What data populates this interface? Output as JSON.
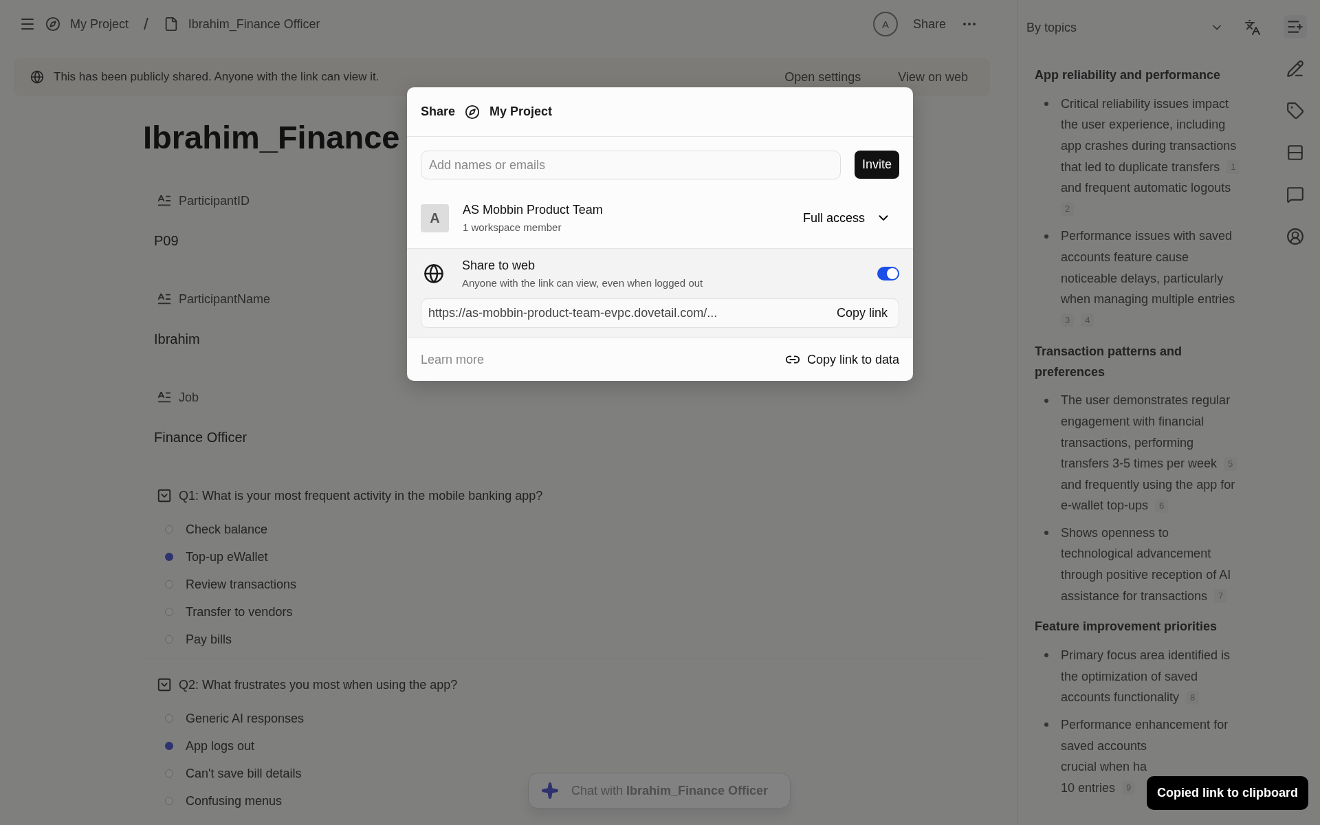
{
  "topbar": {
    "breadcrumb": [
      {
        "kind": "project",
        "label": "My Project"
      },
      {
        "kind": "document",
        "label": "Ibrahim_Finance Officer"
      }
    ],
    "separator": "/",
    "avatar": "A",
    "share": "Share"
  },
  "banner": {
    "text": "This has been publicly shared. Anyone with the link can view it.",
    "actions": [
      "Open settings",
      "View on web"
    ]
  },
  "document": {
    "title": "Ibrahim_Finance",
    "fields": [
      {
        "label": "ParticipantID",
        "value": "P09"
      },
      {
        "label": "ParticipantName",
        "value": "Ibrahim"
      },
      {
        "label": "Job",
        "value": "Finance Officer"
      }
    ],
    "questions": [
      {
        "label": "Q1: What is your most frequent activity in the mobile banking app?",
        "options": [
          {
            "label": "Check balance",
            "selected": false
          },
          {
            "label": "Top-up eWallet",
            "selected": true
          },
          {
            "label": "Review transactions",
            "selected": false
          },
          {
            "label": "Transfer to vendors",
            "selected": false
          },
          {
            "label": "Pay bills",
            "selected": false
          }
        ]
      },
      {
        "label": "Q2: What frustrates you most when using the app?",
        "options": [
          {
            "label": "Generic AI responses",
            "selected": false
          },
          {
            "label": "App logs out",
            "selected": true
          },
          {
            "label": "Can't save bill details",
            "selected": false
          },
          {
            "label": "Confusing menus",
            "selected": false
          }
        ]
      }
    ]
  },
  "chat": {
    "placeholder": "Chat with **Ibrahim_Finance Officer**"
  },
  "sidebar": {
    "grouping": "By topics",
    "sections": [
      {
        "heading": "App reliability and performance",
        "bullets": [
          {
            "lines": [
              {
                "text": "Critical reliability issues impact"
              },
              {
                "text": "the user experience, including"
              },
              {
                "text": "app crashes during transactions"
              },
              {
                "text": "that led to duplicate transfers",
                "citations": [
                  "1"
                ]
              },
              {
                "text": "and frequent automatic logouts"
              },
              {
                "citations": [
                  "2"
                ]
              }
            ]
          },
          {
            "lines": [
              {
                "text": "Performance issues with saved"
              },
              {
                "text": "accounts feature cause"
              },
              {
                "text": "noticeable delays, particularly"
              },
              {
                "text": "when managing multiple entries"
              },
              {
                "citations": [
                  "3",
                  "4"
                ]
              }
            ]
          }
        ]
      },
      {
        "heading": "Transaction patterns and preferences",
        "bullets": [
          {
            "lines": [
              {
                "text": "The user demonstrates regular"
              },
              {
                "text": "engagement with financial"
              },
              {
                "text": "transactions, performing"
              },
              {
                "text": "transfers 3-5 times per week",
                "citations": [
                  "5"
                ]
              },
              {
                "text": "and frequently using the app for"
              },
              {
                "text": "e-wallet top-ups",
                "citations": [
                  "6"
                ]
              }
            ]
          },
          {
            "lines": [
              {
                "text": "Shows openness to"
              },
              {
                "text": "technological advancement"
              },
              {
                "text": "through positive reception of AI"
              },
              {
                "text": "assistance for transactions",
                "citations": [
                  "7"
                ]
              }
            ]
          }
        ]
      },
      {
        "heading": "Feature improvement priorities",
        "bullets": [
          {
            "lines": [
              {
                "text": "Primary focus area identified is"
              },
              {
                "text": "the optimization of saved"
              },
              {
                "text": "accounts functionality",
                "citations": [
                  "8"
                ]
              }
            ]
          },
          {
            "lines": [
              {
                "text": "Performance enhancement for"
              },
              {
                "text": "saved accounts"
              },
              {
                "text": "crucial when ha"
              },
              {
                "text": "10 entries",
                "citations": [
                  "9"
                ]
              }
            ]
          }
        ]
      }
    ]
  },
  "share_dialog": {
    "title": "Share",
    "project": "My Project",
    "invite_placeholder": "Add names or emails",
    "invite_button": "Invite",
    "member": {
      "avatar": "A",
      "name": "AS Mobbin Product Team",
      "detail": "1 workspace member",
      "access": "Full access"
    },
    "web": {
      "title": "Share to web",
      "subtitle": "Anyone with the link can view, even when logged out",
      "on": true,
      "url": "https://as-mobbin-product-team-evpc.dovetail.com/...",
      "copy": "Copy link"
    },
    "learn_more": "Learn more",
    "copy_data": "Copy link to data"
  },
  "toast": "Copied link to clipboard"
}
